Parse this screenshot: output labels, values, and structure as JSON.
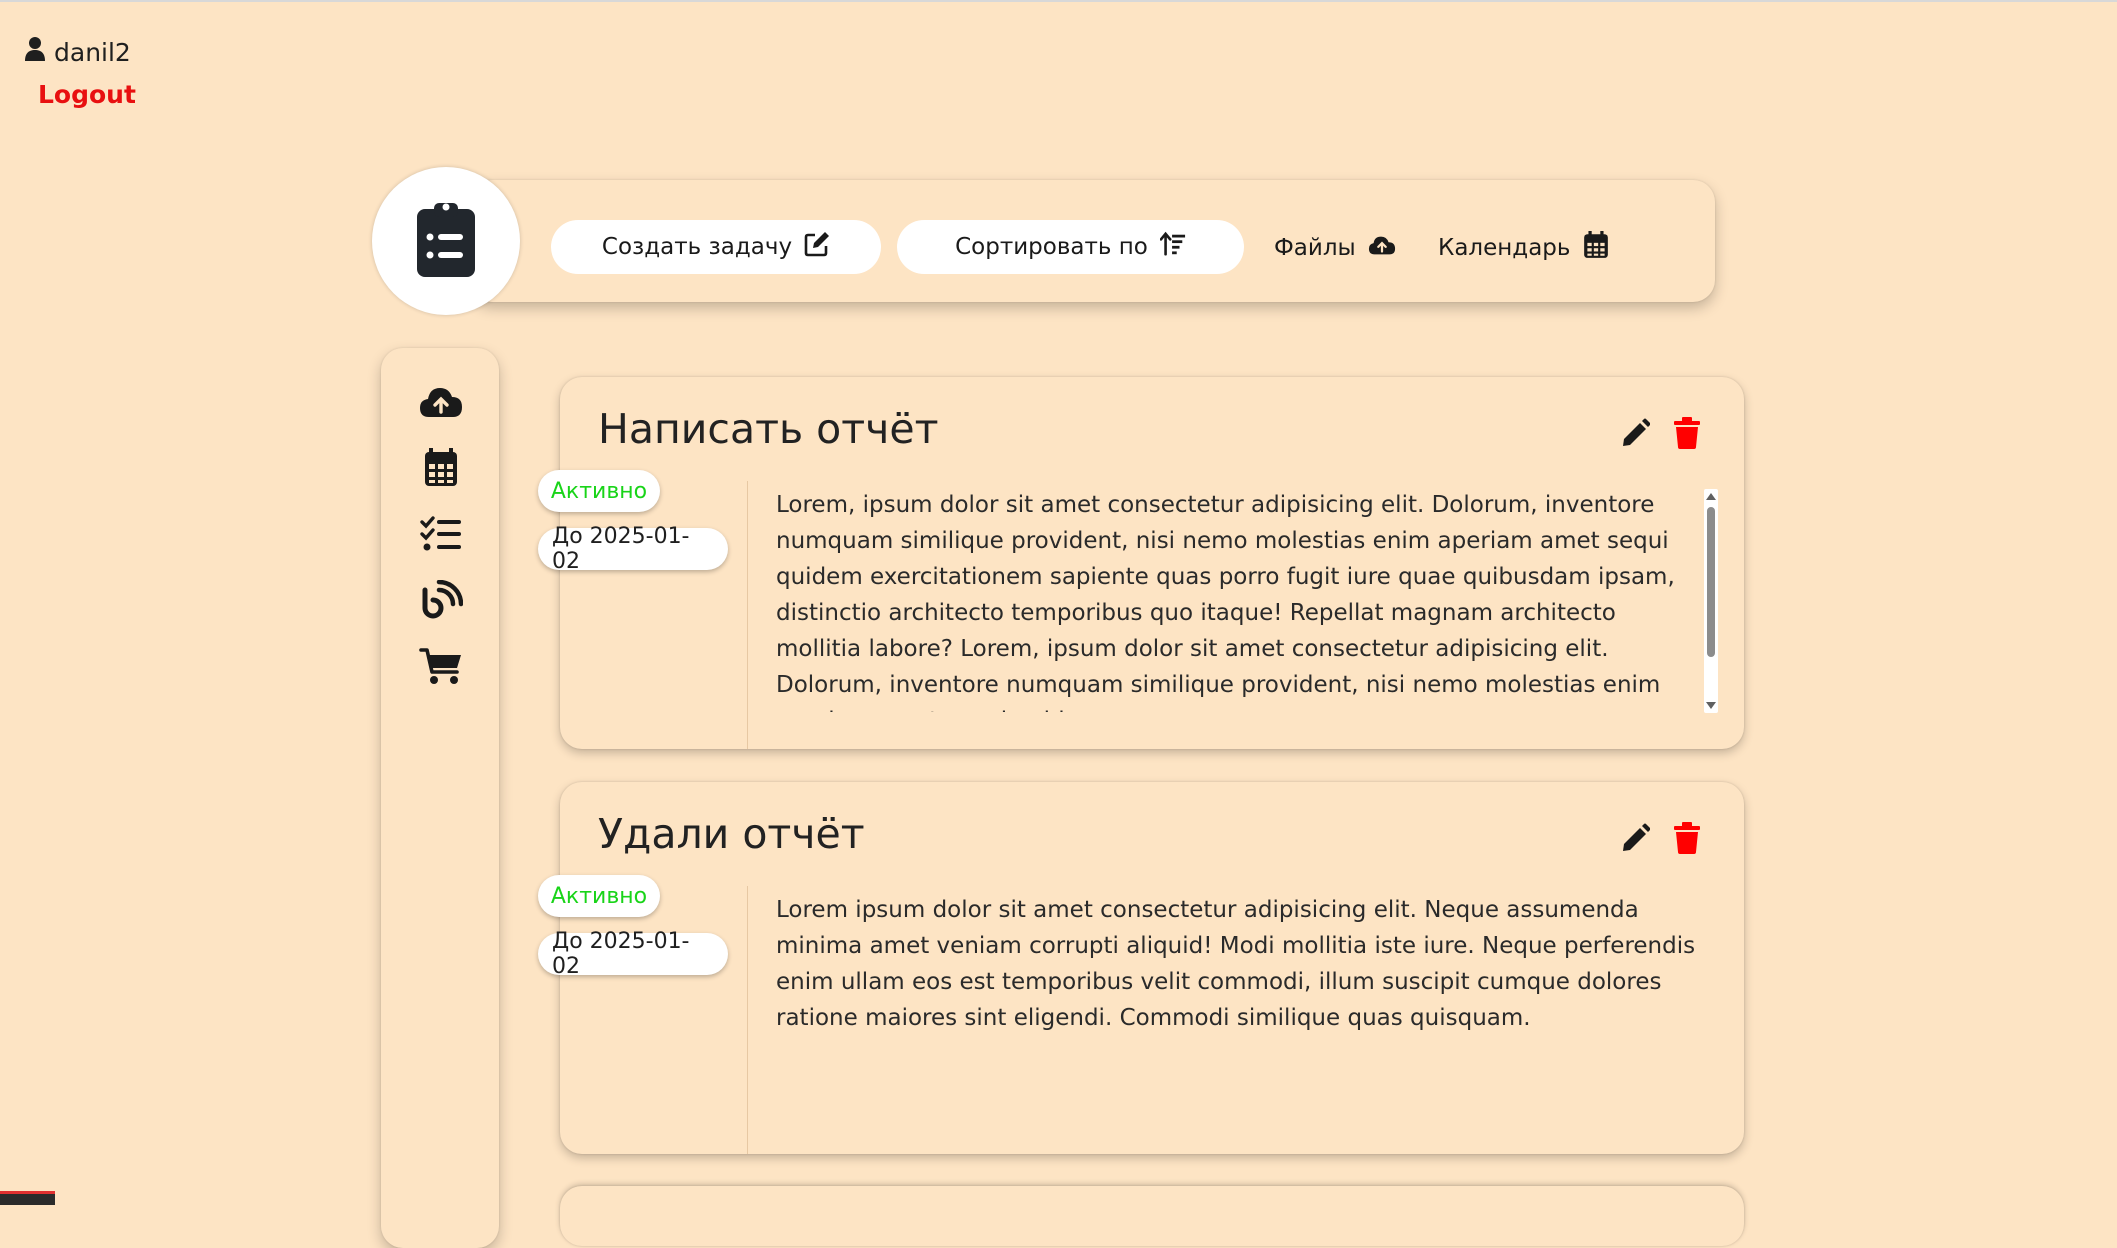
{
  "user": {
    "name": "danil2",
    "logout_label": "Logout"
  },
  "toolbar": {
    "create_label": "Создать задачу",
    "sort_label": "Сортировать по",
    "files_label": "Файлы",
    "calendar_label": "Календарь"
  },
  "sidebar": {
    "items": [
      {
        "icon": "cloud-upload-icon"
      },
      {
        "icon": "calendar-icon"
      },
      {
        "icon": "task-list-icon"
      },
      {
        "icon": "blog-icon"
      },
      {
        "icon": "cart-icon"
      }
    ]
  },
  "tasks": [
    {
      "title": "Написать отчёт",
      "status": "Активно",
      "due": "До 2025-01-02",
      "text": "Lorem, ipsum dolor sit amet consectetur adipisicing elit. Dolorum, inventore numquam similique provident, nisi nemo molestias enim aperiam amet sequi quidem exercitationem sapiente quas porro fugit iure quae quibusdam ipsam, distinctio architecto temporibus quo itaque! Repellat magnam architecto mollitia labore? Lorem, ipsum dolor sit amet consectetur adipisicing elit. Dolorum, inventore numquam similique provident, nisi nemo molestias enim aperiam amet sequi quidem"
    },
    {
      "title": "Удали отчёт",
      "status": "Активно",
      "due": "До 2025-01-02",
      "text": "Lorem ipsum dolor sit amet consectetur adipisicing elit. Neque assumenda minima amet veniam corrupti aliquid! Modi mollitia iste iure. Neque perferendis enim ullam eos est temporibus velit commodi, illum suscipit cumque dolores ratione maiores sint eligendi. Commodi similique quas quisquam."
    }
  ],
  "colors": {
    "background": "#fde4c4",
    "logout": "#e81010",
    "status_active": "#19d419",
    "delete": "#ff0000"
  }
}
